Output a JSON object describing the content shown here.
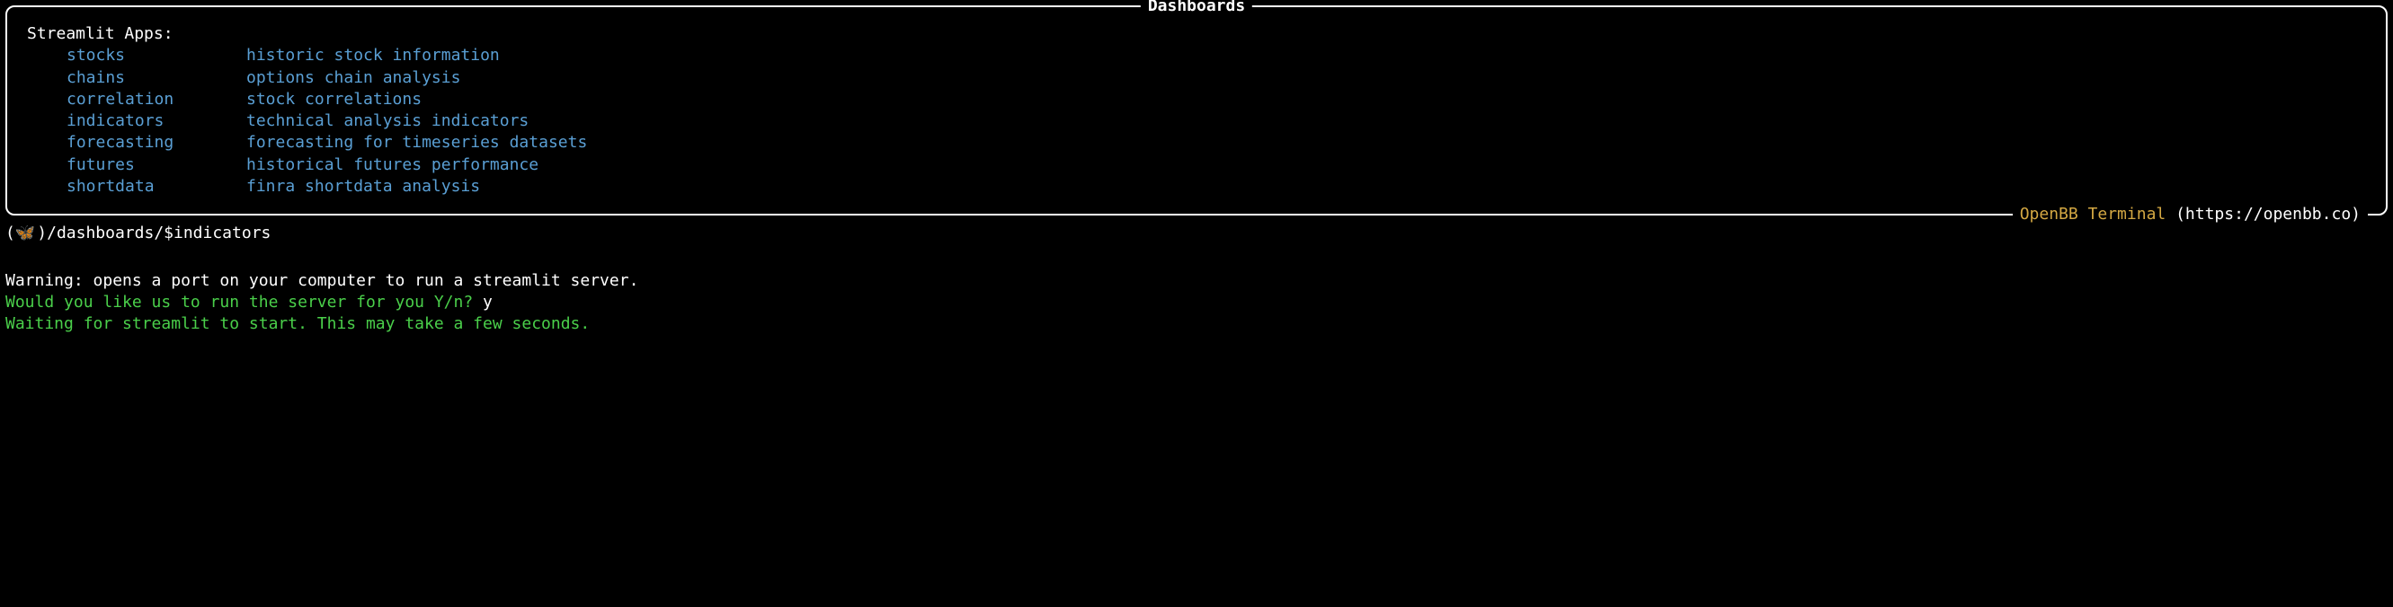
{
  "panel": {
    "title": "Dashboards",
    "section_header": "Streamlit Apps:",
    "items": [
      {
        "name": "stocks",
        "desc": "historic stock information"
      },
      {
        "name": "chains",
        "desc": "options chain analysis"
      },
      {
        "name": "correlation",
        "desc": "stock correlations"
      },
      {
        "name": "indicators",
        "desc": "technical analysis indicators"
      },
      {
        "name": "forecasting",
        "desc": "forecasting for timeseries datasets"
      },
      {
        "name": "futures",
        "desc": "historical futures performance"
      },
      {
        "name": "shortdata",
        "desc": "finra shortdata analysis"
      }
    ],
    "footer": {
      "brand": "OpenBB Terminal",
      "url": " (https://openbb.co) "
    }
  },
  "prompt": {
    "butterfly": "🦋",
    "open_paren": "(",
    "close_paren": ")",
    "path": " /dashboards/ ",
    "dollar": "$ ",
    "command": "indicators"
  },
  "output": {
    "warning": "Warning: opens a port on your computer to run a streamlit server.",
    "question": "Would you like us to run the server for you Y/n? ",
    "answer": "y",
    "waiting": "Waiting for streamlit to start. This may take a few seconds."
  }
}
